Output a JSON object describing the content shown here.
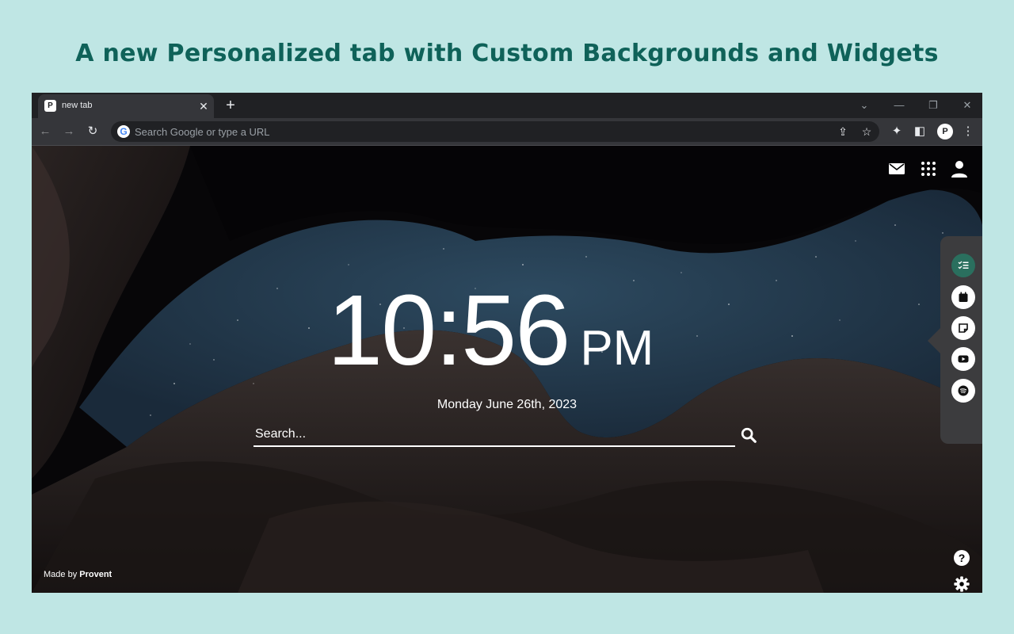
{
  "headline": "A new Personalized tab with Custom Backgrounds and Widgets",
  "browser": {
    "tab": {
      "title": "new tab",
      "favicon": "provent-icon"
    },
    "omnibox": {
      "placeholder": "Search Google or type a URL"
    },
    "profile_initial": "P"
  },
  "page": {
    "clock": {
      "time": "10:56",
      "ampm": "PM"
    },
    "date": "Monday June 26th, 2023",
    "search": {
      "placeholder": "Search..."
    },
    "footer": {
      "prefix": "Made by ",
      "brand": "Provent"
    },
    "help_label": "?",
    "top_icons": [
      "mail-icon",
      "apps-grid-icon",
      "account-icon"
    ],
    "widgets": [
      "todo-icon",
      "calendar-icon",
      "sticky-note-icon",
      "youtube-icon",
      "spotify-icon"
    ]
  },
  "colors": {
    "headline": "#0f6259",
    "page_bg": "#bfe6e4",
    "active_widget": "#2a6f5e",
    "panel": "#3c3c3e"
  }
}
